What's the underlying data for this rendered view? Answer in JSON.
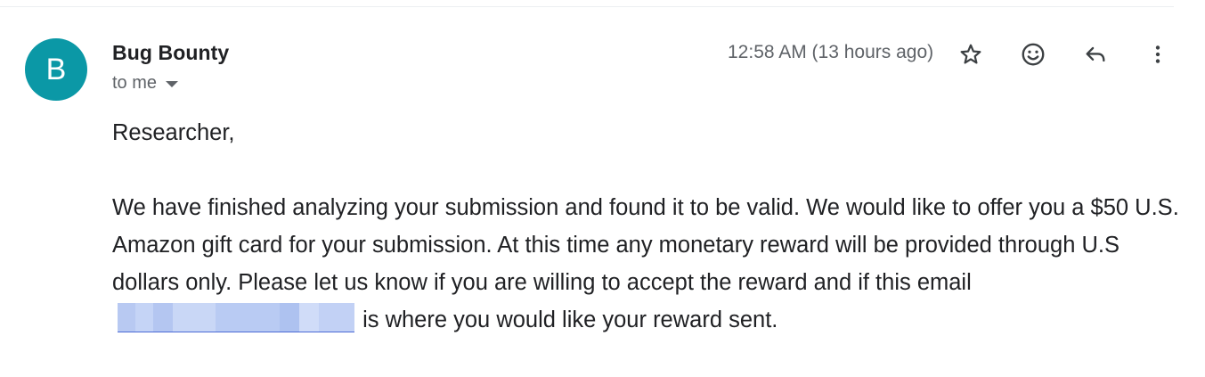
{
  "email": {
    "avatar_letter": "B",
    "sender": "Bug Bounty",
    "recipient": "to me",
    "timestamp": "12:58 AM (13 hours ago)",
    "greeting": "Researcher,",
    "body_part1": "We have finished analyzing your submission and found it to be valid. We would like to offer you a $50 U.S. Amazon gift card for your submission. At this time any monetary reward will be provided through U.S dollars only. Please let us know if you are willing to accept the reward and if this email",
    "body_part2": " is where you would like your reward sent."
  },
  "actions": {
    "star": "star-icon",
    "emoji": "emoji-icon",
    "reply": "reply-icon",
    "more": "more-vert-icon"
  },
  "colors": {
    "avatar_bg": "#0b98a6",
    "text": "#202124",
    "secondary_text": "#5f6368",
    "redaction": "#b8c9f2"
  }
}
